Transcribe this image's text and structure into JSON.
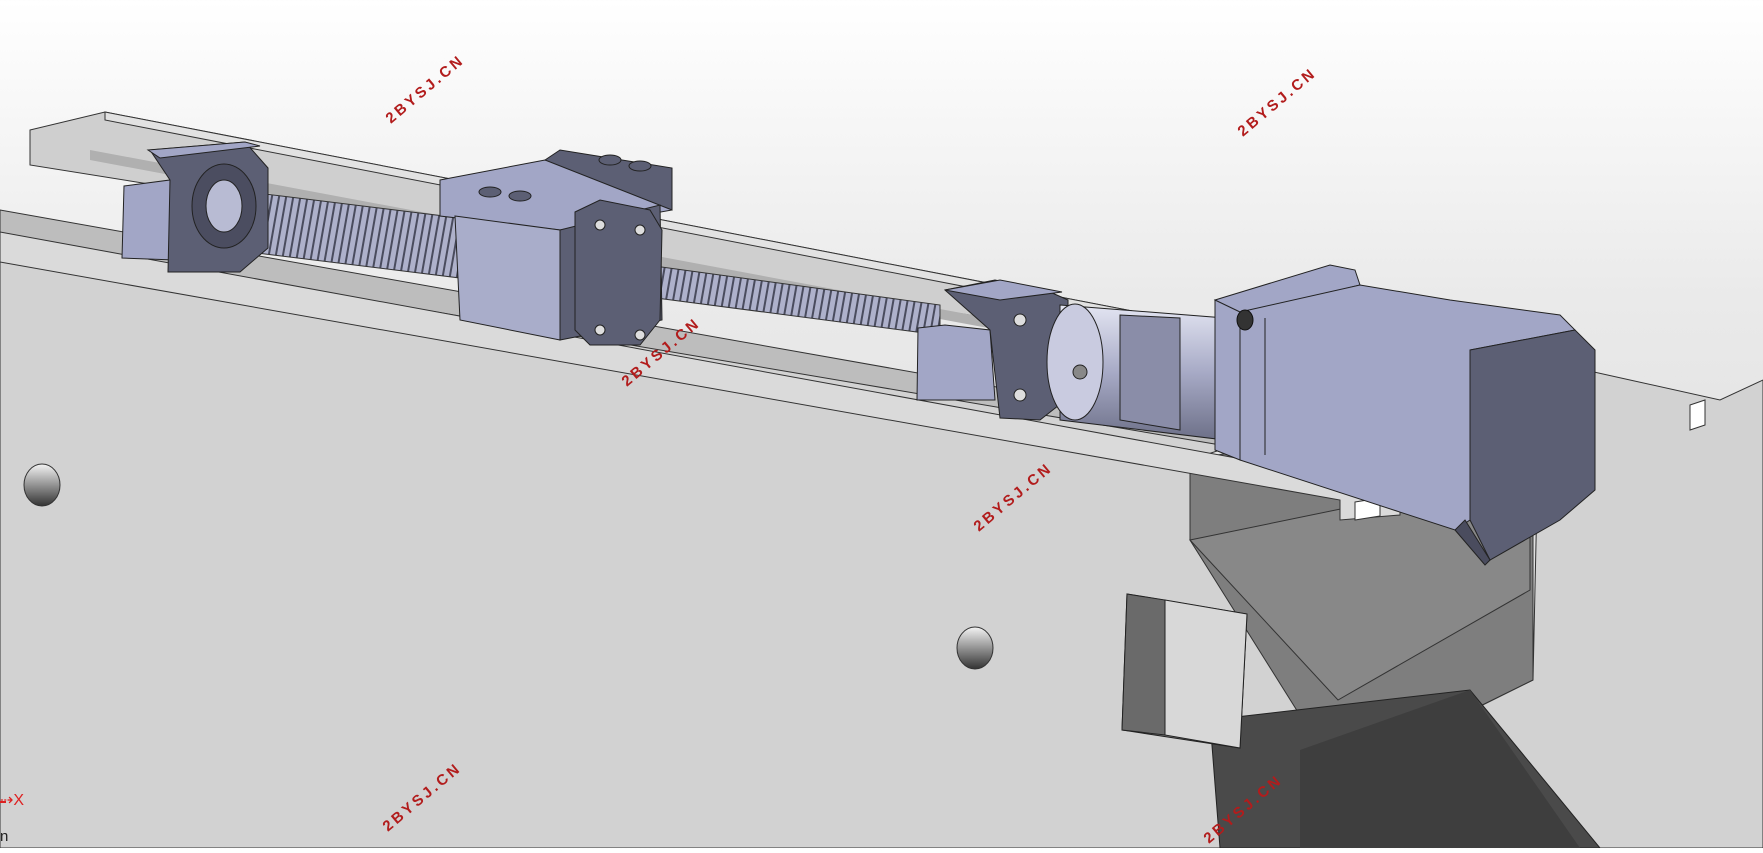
{
  "viewport": {
    "watermarks": [
      "2BYSJ.CN",
      "2BYSJ.CN",
      "2BYSJ.CN",
      "2BYSJ.CN",
      "2BYSJ.CN",
      "2BYSJ.CN"
    ],
    "triad": {
      "axis_symbol": "⇢",
      "axis_label": "X"
    },
    "view_label": "n"
  },
  "colors": {
    "part_steel": "#a2a6c6",
    "part_dark": "#5c5f74",
    "base_light": "#d2d2d2",
    "base_top": "#bdbdbd",
    "base_dark": "#7e7e7e",
    "watermark": "#b21c1c"
  }
}
